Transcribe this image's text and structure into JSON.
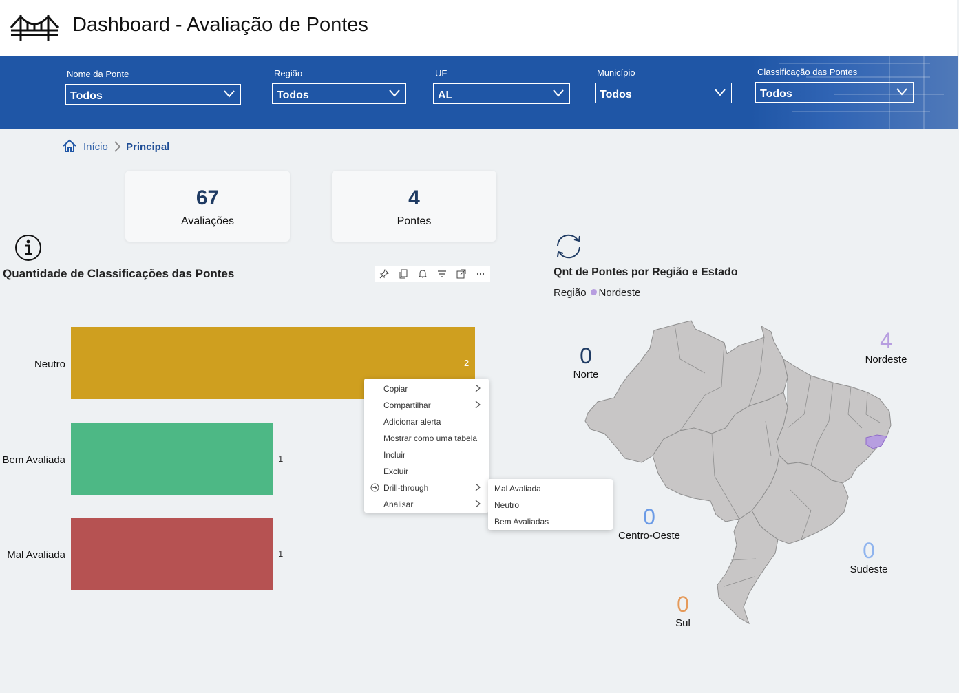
{
  "header": {
    "title": "Dashboard - Avaliação de Pontes",
    "logo_icon": "bridge-icon"
  },
  "filters": [
    {
      "label": "Nome da Ponte",
      "value": "Todos"
    },
    {
      "label": "Região",
      "value": "Todos"
    },
    {
      "label": "UF",
      "value": "AL"
    },
    {
      "label": "Município",
      "value": "Todos"
    },
    {
      "label": "Classificação das Pontes",
      "value": "Todos"
    }
  ],
  "breadcrumb": {
    "home": "Início",
    "current": "Principal"
  },
  "cards": [
    {
      "value": "67",
      "label": "Avaliações"
    },
    {
      "value": "4",
      "label": "Pontes"
    }
  ],
  "bar_chart": {
    "title": "Quantidade de Classificações das Pontes",
    "toolbar_icons": [
      "pin-icon",
      "copy-icon",
      "bell-icon",
      "filter-icon",
      "focus-mode-icon",
      "more-options-icon"
    ]
  },
  "chart_data": {
    "type": "bar",
    "orientation": "horizontal",
    "title": "Quantidade de Classificações das Pontes",
    "categories": [
      "Neutro",
      "Bem Avaliada",
      "Mal Avaliada"
    ],
    "values": [
      2,
      1,
      1
    ],
    "value_labels": [
      "2",
      "1",
      "1"
    ],
    "colors": [
      "#cf9f1f",
      "#4db885",
      "#b65252"
    ],
    "xlim": [
      0,
      2
    ]
  },
  "context_menu": {
    "items": [
      {
        "label": "Copiar",
        "submenu": true
      },
      {
        "label": "Compartilhar",
        "submenu": true
      },
      {
        "label": "Adicionar alerta",
        "submenu": false
      },
      {
        "label": "Mostrar como uma tabela",
        "submenu": false
      },
      {
        "label": "Incluir",
        "submenu": false
      },
      {
        "label": "Excluir",
        "submenu": false
      },
      {
        "label": "Drill-through",
        "submenu": true
      },
      {
        "label": "Analisar",
        "submenu": true
      }
    ],
    "drill_submenu": [
      "Mal Avaliada",
      "Neutro",
      "Bem Avaliadas"
    ]
  },
  "map": {
    "title": "Qnt de Pontes por Região e Estado",
    "legend_title": "Região",
    "legend_item": "Nordeste",
    "highlight_color": "#b79ee0",
    "regions": [
      {
        "name": "Norte",
        "value": "0",
        "color": "#1f3b63"
      },
      {
        "name": "Nordeste",
        "value": "4",
        "color": "#b79ee0"
      },
      {
        "name": "Centro-Oeste",
        "value": "0",
        "color": "#6b9be6"
      },
      {
        "name": "Sudeste",
        "value": "0",
        "color": "#8fb4ee"
      },
      {
        "name": "Sul",
        "value": "0",
        "color": "#e59a5a"
      }
    ]
  }
}
